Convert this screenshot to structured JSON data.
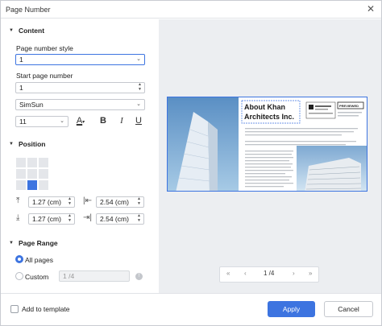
{
  "dialog": {
    "title": "Page Number",
    "close_icon": "✕"
  },
  "content": {
    "section_label": "Content",
    "style_label": "Page number style",
    "style_value": "1",
    "start_label": "Start page number",
    "start_value": "1",
    "font_value": "SimSun",
    "size_value": "11",
    "bold": "B",
    "italic": "I",
    "underline": "U",
    "font_color_letter": "A"
  },
  "position": {
    "section_label": "Position",
    "grid_selected_index": 7,
    "top_margin": "1.27 (cm)",
    "left_margin": "2.54 (cm)",
    "bottom_margin": "1.27 (cm)",
    "right_margin": "2.54 (cm)"
  },
  "page_range": {
    "section_label": "Page Range",
    "all_pages_label": "All pages",
    "custom_label": "Custom",
    "custom_value": "1 /4"
  },
  "preview": {
    "doc_title_line1": "About Khan",
    "doc_title_line2": "Architects Inc.",
    "stamp": "PREVIEWED",
    "pager": {
      "first": "«",
      "prev": "‹",
      "current": "1 /4",
      "next": "›",
      "last": "»"
    }
  },
  "footer": {
    "add_to_template_label": "Add to template",
    "apply_label": "Apply",
    "cancel_label": "Cancel"
  },
  "colors": {
    "accent": "#3d74e0",
    "preview_bg": "#eceef1"
  }
}
